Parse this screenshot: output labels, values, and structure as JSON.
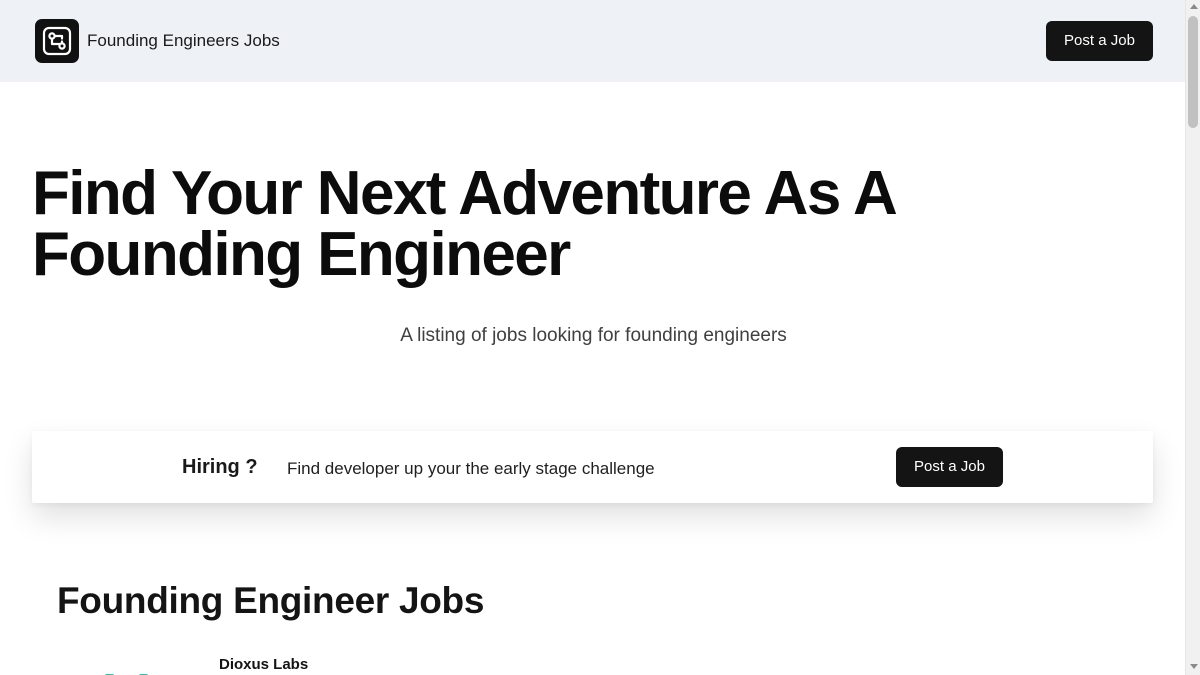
{
  "header": {
    "brand": "Founding Engineers Jobs",
    "logo_icon": "circuit-logo-icon",
    "post_job_label": "Post a Job"
  },
  "hero": {
    "title": "Find Your Next Adventure As A Founding Engineer",
    "subtitle": "A listing of jobs looking for founding engineers"
  },
  "banner": {
    "title": "Hiring ?",
    "text": "Find developer up your the early stage challenge",
    "button_label": "Post a Job"
  },
  "jobs": {
    "heading": "Founding Engineer Jobs",
    "items": [
      {
        "company": "Dioxus Labs"
      }
    ]
  },
  "colors": {
    "header_bg": "#eef2f7",
    "button_bg": "#141414",
    "accent": "#34c3a5"
  }
}
